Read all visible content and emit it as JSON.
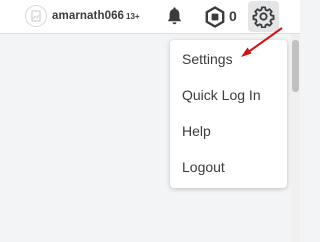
{
  "header": {
    "username": "amarnath066",
    "age_badge": "13+",
    "robux_count": "0"
  },
  "icons": {
    "avatar": "avatar-placeholder",
    "notifications": "bell-icon",
    "currency": "robux-icon",
    "settings": "gear-icon"
  },
  "settings_menu": {
    "items": [
      {
        "label": "Settings"
      },
      {
        "label": "Quick Log In"
      },
      {
        "label": "Help"
      },
      {
        "label": "Logout"
      }
    ]
  },
  "colors": {
    "text": "#393b3d",
    "annotation_arrow": "#d0131b",
    "gear_active_bg": "#e3e5e6"
  }
}
